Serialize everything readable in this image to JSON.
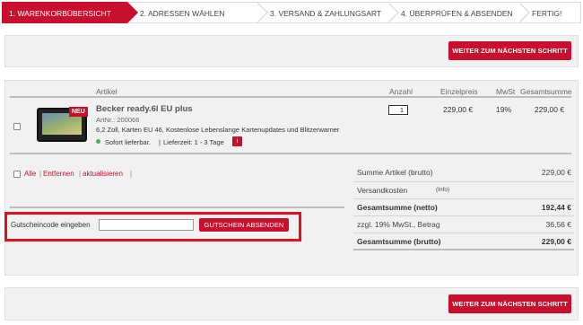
{
  "steps": [
    {
      "label": "1. WARENKORBÜBERSICHT"
    },
    {
      "label": "2. ADRESSEN WÄHLEN"
    },
    {
      "label": "3. VERSAND & ZAHLUNGSART"
    },
    {
      "label": "4. ÜBERPRÜFEN & ABSENDEN"
    },
    {
      "label": "FERTIG!"
    }
  ],
  "top": {
    "next_button": "WEITER ZUM NÄCHSTEN SCHRITT"
  },
  "bottom": {
    "next_button": "WEITER ZUM NÄCHSTEN SCHRITT"
  },
  "table": {
    "headers": {
      "article": "Artikel",
      "quantity": "Anzahl",
      "unit_price": "Einzelpreis",
      "vat": "MwSt",
      "total": "Gesamtsumme"
    }
  },
  "product": {
    "badge": "NEU",
    "name": "Becker ready.6l EU plus",
    "art_nr": "ArtNr.: 200066",
    "description": "6,2 Zoll, Karten EU 46, Kostenlose Lebenslange Kartenupdates und Blitzerwarner",
    "availability": "Sofort lieferbar.",
    "delivery": "Lieferzeit: 1 - 3 Tage",
    "info_icon": "i",
    "quantity": "1",
    "unit_price": "229,00 €",
    "vat": "19%",
    "total": "229,00 €"
  },
  "actions": {
    "all": "Alle",
    "remove": "Entfernen",
    "update": "aktualisieren"
  },
  "summary": {
    "subtotal_label": "Summe Artikel (brutto)",
    "subtotal_value": "229,00 €",
    "shipping_label": "Versandkosten",
    "shipping_info": "(Info)",
    "net_label": "Gesamtsumme (netto)",
    "net_value": "192,44 €",
    "vat_label": "zzgl. 19% MwSt., Betrag",
    "vat_value": "36,56 €",
    "gross_label": "Gesamtsumme (brutto)",
    "gross_value": "229,00 €"
  },
  "coupon": {
    "label": "Gutscheincode eingeben",
    "value": "",
    "button": "GUTSCHEIN ABSENDEN"
  },
  "colors": {
    "accent": "#c8102e",
    "highlight": "#e01020",
    "panel": "#f1f1f1"
  }
}
